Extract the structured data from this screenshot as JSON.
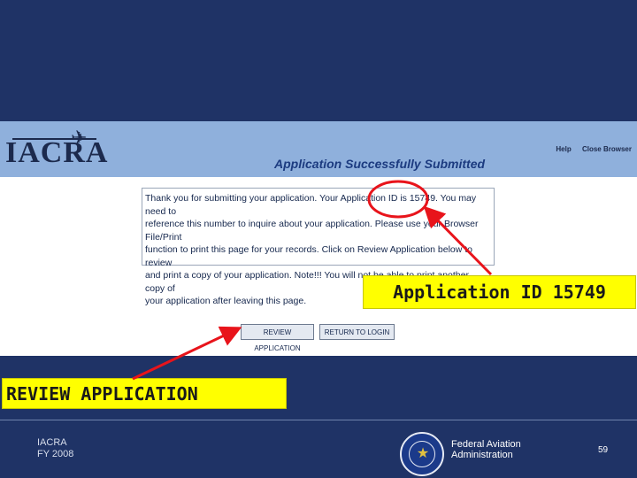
{
  "app": {
    "logo_text": "IACRA",
    "top_links": [
      "Help",
      "Close Browser"
    ]
  },
  "page": {
    "title": "Application Successfully Submitted",
    "message_lines": [
      "Thank you for submitting your application. Your Application ID is 15749. You may need to",
      "reference this number to inquire about your application. Please use your Browser File/Print",
      "function to print this page for your records. Click on Review Application below to review",
      "and print a copy of your application. Note!!! You will not be able to print another copy of",
      "your application after leaving this page."
    ],
    "buttons": {
      "review": "REVIEW APPLICATION",
      "return_login": "RETURN TO LOGIN"
    }
  },
  "annotations": {
    "application_id_callout": "Application ID 15749",
    "review_callout": "REVIEW APPLICATION",
    "highlight_color": "#ffff00",
    "arrow_color": "#e8141b"
  },
  "footer": {
    "left_line1": "IACRA",
    "left_line2": "FY 2008",
    "agency_line1": "Federal Aviation",
    "agency_line2": "Administration",
    "slide_number": "59"
  },
  "colors": {
    "slide_background": "#1f3366",
    "header_bar": "#8fb0dc",
    "title_text": "#1c3b80"
  }
}
